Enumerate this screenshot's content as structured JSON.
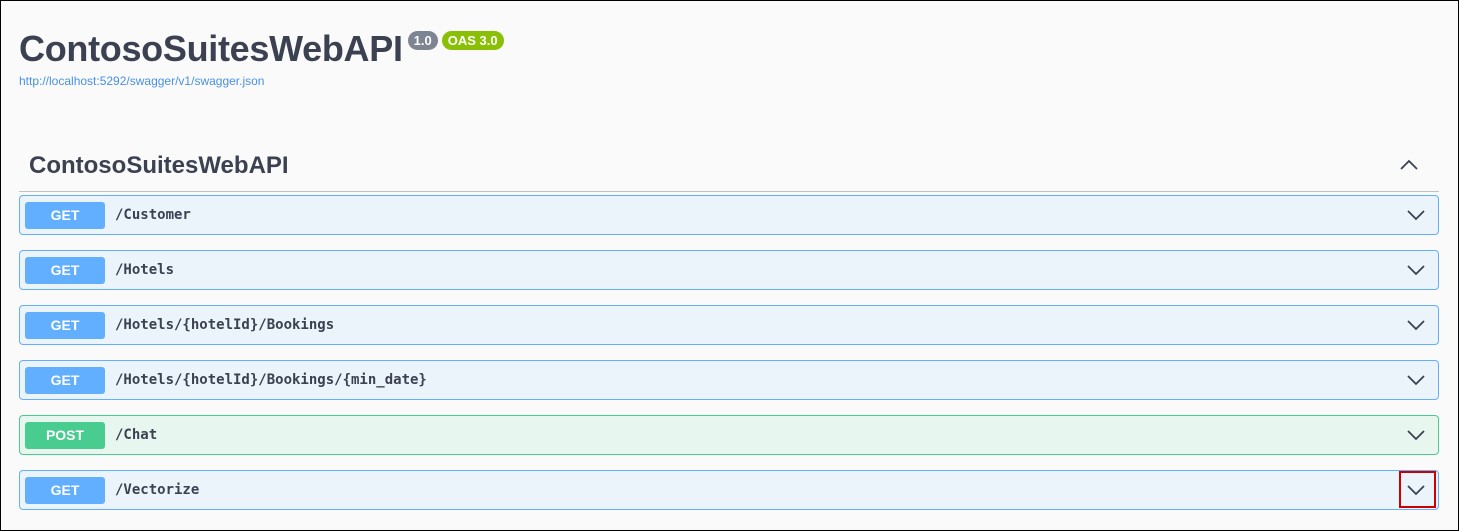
{
  "info": {
    "title": "ContosoSuitesWebAPI",
    "version": "1.0",
    "oas": "OAS 3.0",
    "spec_url": "http://localhost:5292/swagger/v1/swagger.json"
  },
  "tag": {
    "name": "ContosoSuitesWebAPI",
    "toggle_icon": "chevron-up-icon"
  },
  "operations": [
    {
      "method": "GET",
      "path": "/Customer"
    },
    {
      "method": "GET",
      "path": "/Hotels"
    },
    {
      "method": "GET",
      "path": "/Hotels/{hotelId}/Bookings"
    },
    {
      "method": "GET",
      "path": "/Hotels/{hotelId}/Bookings/{min_date}"
    },
    {
      "method": "POST",
      "path": "/Chat"
    },
    {
      "method": "GET",
      "path": "/Vectorize"
    }
  ],
  "colors": {
    "get": "#61affe",
    "post": "#49cc90",
    "highlight": "#cc0000"
  }
}
